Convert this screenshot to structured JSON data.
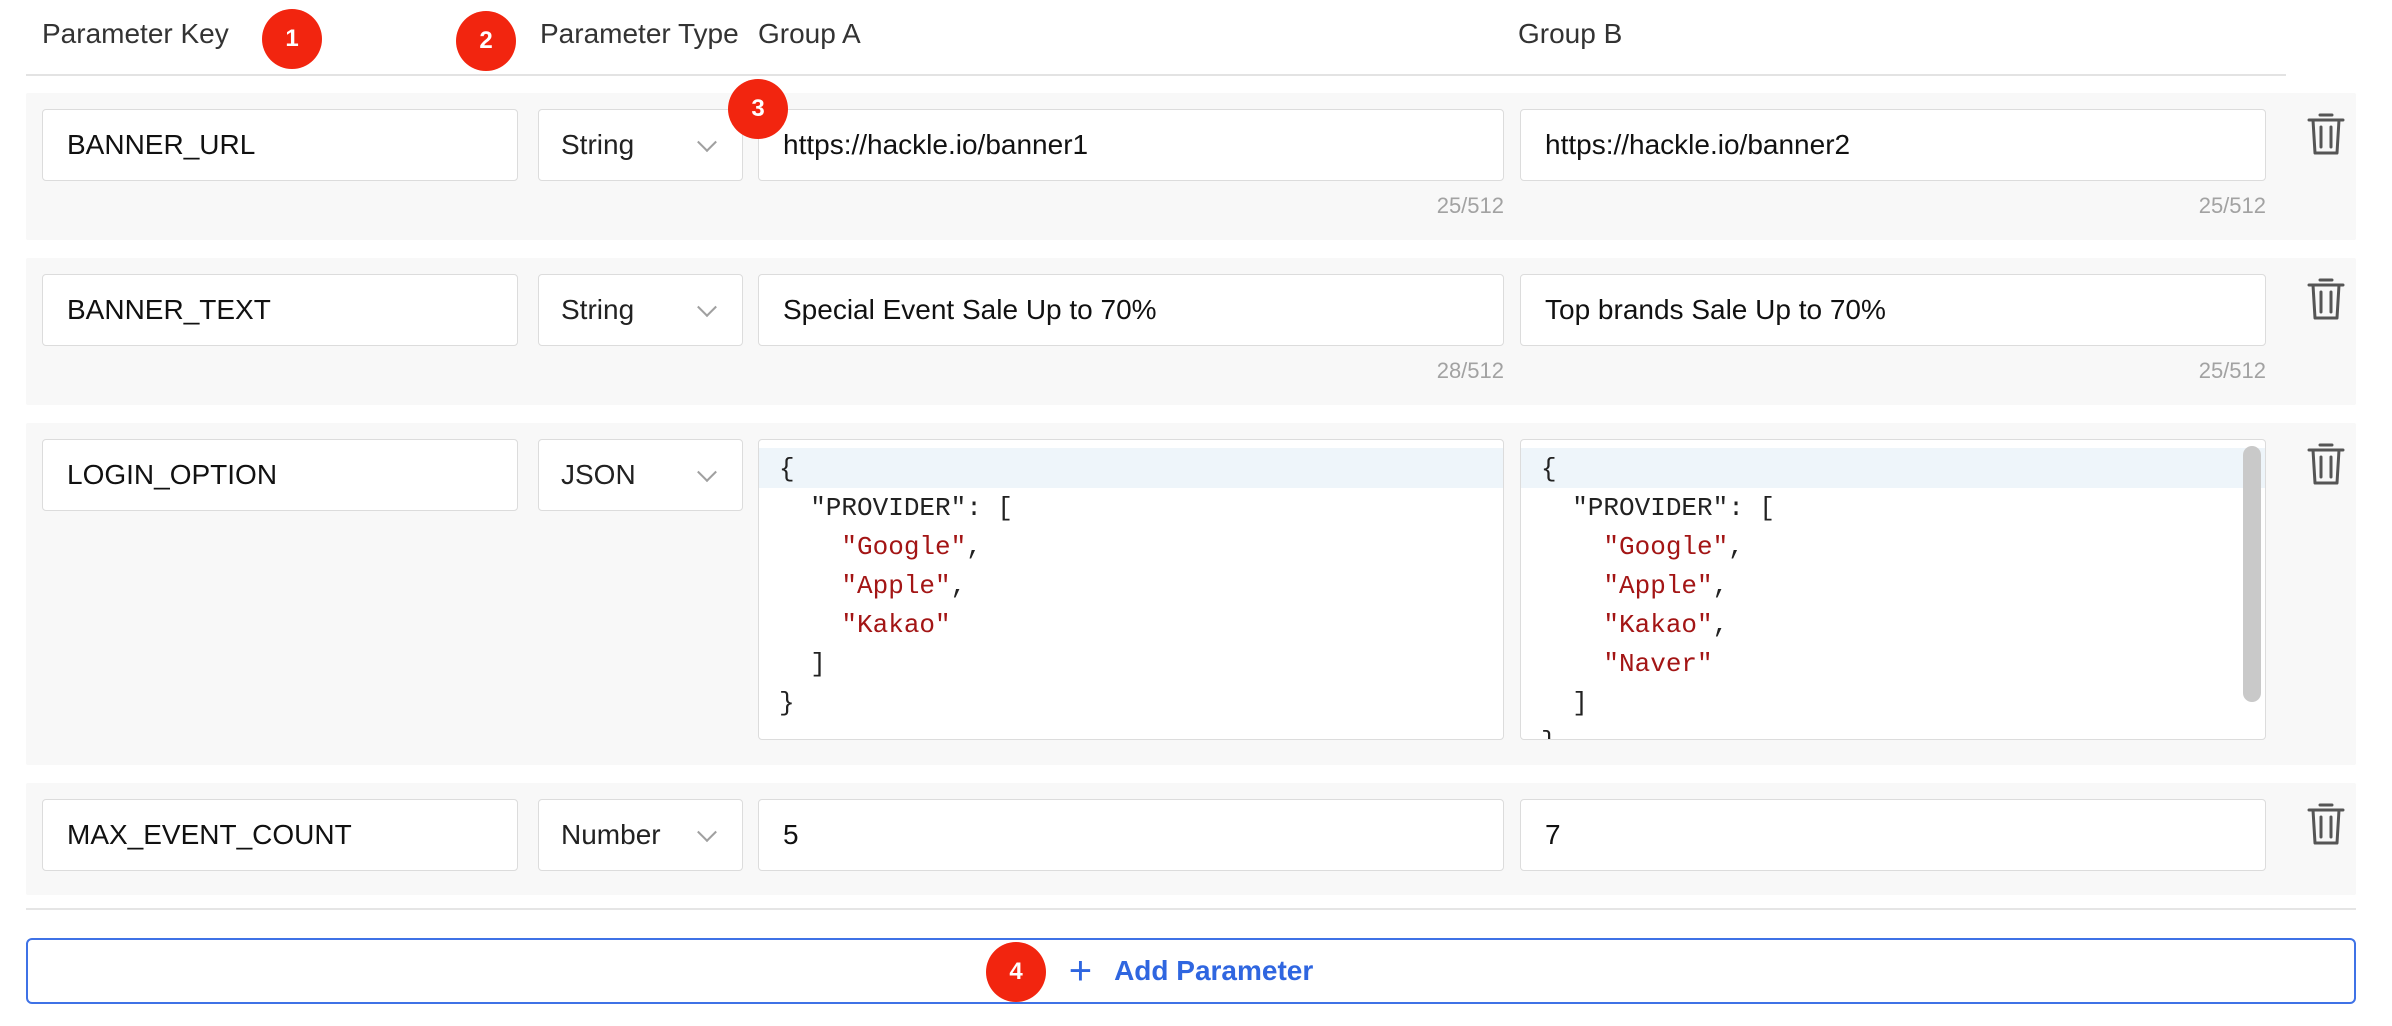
{
  "header": {
    "key_label": "Parameter Key",
    "type_label": "Parameter Type",
    "group_a_label": "Group A",
    "group_b_label": "Group B"
  },
  "rows": [
    {
      "key": "BANNER_URL",
      "type": "String",
      "group_a": "https://hackle.io/banner1",
      "group_a_count": "25/512",
      "group_b": "https://hackle.io/banner2",
      "group_b_count": "25/512"
    },
    {
      "key": "BANNER_TEXT",
      "type": "String",
      "group_a": "Special Event Sale Up to 70%",
      "group_a_count": "28/512",
      "group_b": "Top brands Sale Up to 70%",
      "group_b_count": "25/512"
    },
    {
      "key": "LOGIN_OPTION",
      "type": "JSON",
      "group_a_code": [
        "{",
        "  \"PROVIDER\": [",
        "    \"Google\",",
        "    \"Apple\",",
        "    \"Kakao\"",
        "  ]",
        "}"
      ],
      "group_b_code": [
        "{",
        "  \"PROVIDER\": [",
        "    \"Google\",",
        "    \"Apple\",",
        "    \"Kakao\",",
        "    \"Naver\"",
        "  ]",
        "}"
      ]
    },
    {
      "key": "MAX_EVENT_COUNT",
      "type": "Number",
      "group_a": "5",
      "group_b": "7"
    }
  ],
  "badges": [
    "1",
    "2",
    "3",
    "4"
  ],
  "add_button": {
    "label": "Add Parameter",
    "icon": "plus-icon"
  },
  "icons": {
    "delete": "trash-icon",
    "dropdown": "chevron-down-icon"
  },
  "colors": {
    "accent": "#2f66e0",
    "badge": "#f2250f",
    "json_string": "#a31515"
  }
}
